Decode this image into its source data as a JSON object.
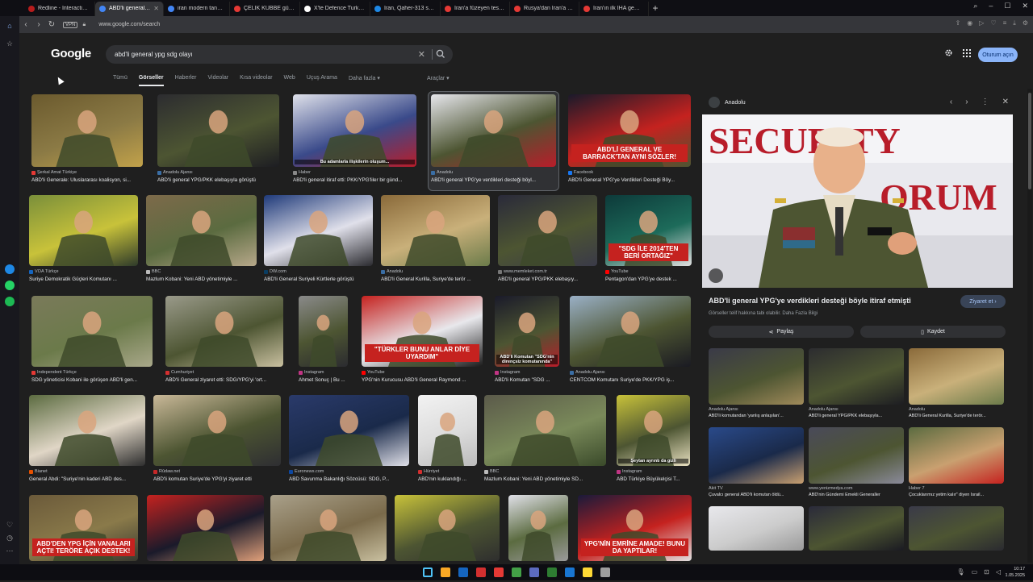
{
  "browser": {
    "tabs": [
      {
        "label": "Redline - Interactive Stori",
        "color": "#b71c1c",
        "active": false
      },
      {
        "label": "ABD'li general ypg sdg ol",
        "color": "#4285f4",
        "active": true
      },
      {
        "label": "iran modern tank - Googl",
        "color": "#4285f4",
        "active": false
      },
      {
        "label": "ÇELİK KUBBE güçleniyor!",
        "color": "#e53935",
        "active": false
      },
      {
        "label": "X'te Defence Turk: \"Iran",
        "color": "#ffffff",
        "active": false
      },
      {
        "label": "İran, Qaher-313 savaş uç",
        "color": "#1e88e5",
        "active": false
      },
      {
        "label": "İran'a füzeyen teslim edi",
        "color": "#e53935",
        "active": false
      },
      {
        "label": "Rusya'dan İran'a savaş uç",
        "color": "#e53935",
        "active": false
      },
      {
        "label": "İran'ın ilk İHA gemisi Dev",
        "color": "#e53935",
        "active": false
      }
    ],
    "new_tab": "+",
    "vpn": "VPN",
    "url": "www.google.com/search"
  },
  "google": {
    "logo": "Google",
    "query": "abd'li general ypg sdg olayı",
    "signin": "Oturum açın",
    "filters": [
      "Tümü",
      "Görseller",
      "Haberler",
      "Videolar",
      "Kısa videolar",
      "Web",
      "Uçuş Arama",
      "Daha fazla ▾"
    ],
    "tools": "Araçlar ▾"
  },
  "results": [
    {
      "src": "Şerkal Amat Türkiye",
      "title": "ABD'li Generale: Uluslararası koalisyon, si...",
      "fc": "#e53935"
    },
    {
      "src": "Anadolu Ajansı",
      "title": "ABD'li general YPG/PKK elebaşıyla görüştü",
      "fc": "#3a6ea5"
    },
    {
      "src": "Haber",
      "title": "ABD'li general itiraf etti: PKK/YPG'liler bir günd...",
      "fc": "#888",
      "caption": "Bu adamlarla ilişkilerin oluşum..."
    },
    {
      "src": "Anadolu",
      "title": "ABD'li general YPG'ye verdikleri desteği böyl...",
      "fc": "#3a6ea5"
    },
    {
      "src": "Facebook",
      "title": "ABD'li General YPG'ye Verdikleri Desteği Böy...",
      "fc": "#1877f2",
      "overlay": "ABD'Lİ GENERAL VE BARRACK'TAN AYNI SÖZLER!"
    },
    {
      "src": "VOA Türkçe",
      "title": "Suriye Demokratik Güçleri Komutanı ...",
      "fc": "#1565c0"
    },
    {
      "src": "BBC",
      "title": "Mazlum Kobani: Yeni ABD yönetimiyle ...",
      "fc": "#bbb"
    },
    {
      "src": "DW.com",
      "title": "ABD'li General Suriyeli Kürtlerle görüştü",
      "fc": "#0a3d62"
    },
    {
      "src": "Anadolu",
      "title": "ABD'li General Kurilla, Suriye'de terör ...",
      "fc": "#3a6ea5"
    },
    {
      "src": "www.memleket.com.tr",
      "title": "ABD'li general YPG/PKK elebaşıy...",
      "fc": "#777"
    },
    {
      "src": "YouTube",
      "title": "Pentagon'dan YPG'ye destek ...",
      "fc": "#ff0000",
      "overlay": "\"SDG İLE 2014'TEN BERİ ORTAĞIZ\""
    },
    {
      "src": "Independent Türkçe",
      "title": "SDG yöneticisi Kobani ile görüşen ABD'li gen...",
      "fc": "#e53935"
    },
    {
      "src": "Cumhuriyet",
      "title": "ABD'li General ziyaret etti: SDG/YPG'yi 'ort...",
      "fc": "#d32f2f"
    },
    {
      "src": "Instagram",
      "title": "Ahmet Sonuç | Bu ...",
      "fc": "#c13584"
    },
    {
      "src": "YouTube",
      "title": "YPG'nin Kurucusu ABD'li General Raymond ...",
      "fc": "#ff0000",
      "overlay": "\"TÜRKLER BUNU ANLAR DİYE UYARDIM\""
    },
    {
      "src": "Instagram",
      "title": "ABD'li Komutan \"SDG ...",
      "fc": "#c13584",
      "caption": "ABD'li Komutan \"SDG'nin dirençsiz komutanında\""
    },
    {
      "src": "Anadolu Ajansı",
      "title": "CENTCOM Komutanı Suriye'de PKK/YPG iş...",
      "fc": "#3a6ea5"
    },
    {
      "src": "Bianet",
      "title": "General Abdi: \"Suriye'nin kaderi ABD des...",
      "fc": "#e65100"
    },
    {
      "src": "Rûdaw.net",
      "title": "ABD'li komutan Suriye'de YPG'yi ziyaret etti",
      "fc": "#c62828"
    },
    {
      "src": "Euronews.com",
      "title": "ABD Savunma Bakanlığı Sözcüsü: SDG, P...",
      "fc": "#0d47a1"
    },
    {
      "src": "Hürriyet",
      "title": "ABD'nin kuklandığı ...",
      "fc": "#d32f2f"
    },
    {
      "src": "BBC",
      "title": "Mazlum Kobani: Yeni ABD yönetimiyle SD...",
      "fc": "#bbb"
    },
    {
      "src": "Instagram",
      "title": "ABD Türkiye Büyükelçisi T...",
      "fc": "#c13584",
      "caption": "Şeytan ayrıntı da gizli"
    },
    {
      "src": "",
      "title": "",
      "fc": "#888",
      "overlay": "ABD'DEN YPG İÇİN VANALARI AÇTI! TERÖRE AÇIK DESTEK!"
    },
    {
      "src": "",
      "title": "",
      "fc": "#888"
    },
    {
      "src": "",
      "title": "",
      "fc": "#888"
    },
    {
      "src": "",
      "title": "",
      "fc": "#888"
    },
    {
      "src": "",
      "title": "",
      "fc": "#888"
    },
    {
      "src": "",
      "title": "",
      "fc": "#888",
      "overlay": "YPG'NİN EMRİNE AMADE! BUNU DA YAPTILAR!"
    }
  ],
  "panel": {
    "source": "Anadolu",
    "image_text": "SECURITY FORUM",
    "title": "ABD'li general YPG'ye verdikleri desteği böyle itiraf etmişti",
    "subtitle": "Görseller telif hakkına tabi olabilir. Daha Fazla Bilgi",
    "visit": "Ziyaret et ›",
    "share": "Paylaş",
    "save": "Kaydet",
    "related": [
      {
        "src": "Anadolu Ajansı",
        "title": "ABD'li komutandan 'yanlış anlaşılan'..."
      },
      {
        "src": "Anadolu Ajansı",
        "title": "ABD'li general YPG/PKK elebaşıyla..."
      },
      {
        "src": "Anadolu",
        "title": "ABD'li General Kurilla, Suriye'de terör..."
      },
      {
        "src": "Akit TV",
        "title": "Çuvalcı general ABD'li komutan öldü..."
      },
      {
        "src": "www.yenizmedya.com",
        "title": "ABD'nin Gündemi Emekli Generaller"
      },
      {
        "src": "Haber 7",
        "title": "Çocuklarımız yetim kalır\" diyen İsrail..."
      },
      {
        "src": "",
        "title": ""
      },
      {
        "src": "",
        "title": ""
      },
      {
        "src": "",
        "title": ""
      }
    ]
  },
  "taskbar": {
    "time": "10:17",
    "date": "1.05.2025"
  }
}
